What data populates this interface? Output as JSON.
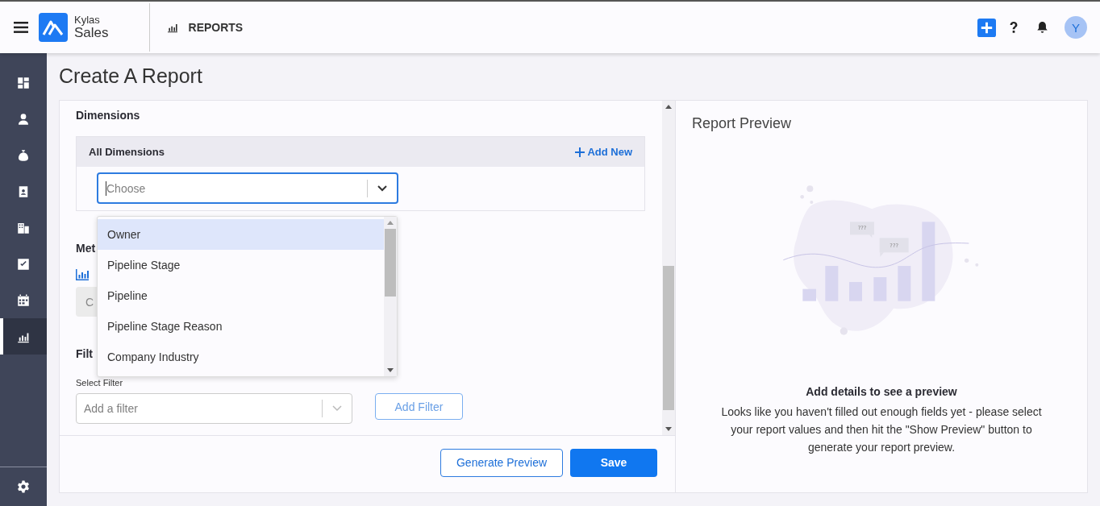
{
  "header": {
    "brand_top": "Kylas",
    "brand_bottom": "Sales",
    "section": "REPORTS",
    "avatar": "Y"
  },
  "sidebar": {
    "items": [
      {
        "kind": "dashboard",
        "selected": false
      },
      {
        "kind": "contacts",
        "selected": false
      },
      {
        "kind": "deals",
        "selected": false
      },
      {
        "kind": "leads",
        "selected": false
      },
      {
        "kind": "companies",
        "selected": false
      },
      {
        "kind": "tasks",
        "selected": false
      },
      {
        "kind": "calendar",
        "selected": false
      },
      {
        "kind": "reports",
        "selected": true
      }
    ]
  },
  "page_title": "Create A Report",
  "form": {
    "dimensions_heading": "Dimensions",
    "all_dimensions": "All Dimensions",
    "add_new": "Add New",
    "dimension_select": {
      "placeholder": "Choose"
    },
    "dropdown_options": [
      {
        "label": "Owner",
        "selected": true
      },
      {
        "label": "Pipeline Stage",
        "selected": false
      },
      {
        "label": "Pipeline",
        "selected": false
      },
      {
        "label": "Pipeline Stage Reason",
        "selected": false
      },
      {
        "label": "Company Industry",
        "selected": false
      }
    ],
    "metrics_heading": "Met",
    "metrics_field": "C",
    "filters_heading": "Filt",
    "select_filter_label": "Select Filter",
    "filter_select": {
      "placeholder": "Add a filter"
    },
    "add_filter": "Add Filter"
  },
  "footer": {
    "generate_preview": "Generate Preview",
    "save": "Save"
  },
  "preview": {
    "title": "Report Preview",
    "bubbles": [
      "???",
      "???"
    ],
    "heading": "Add details to see a preview",
    "message": "Looks like you haven't filled out enough fields yet - please select your report values and then hit the \"Show Preview\" button to generate your report preview."
  }
}
